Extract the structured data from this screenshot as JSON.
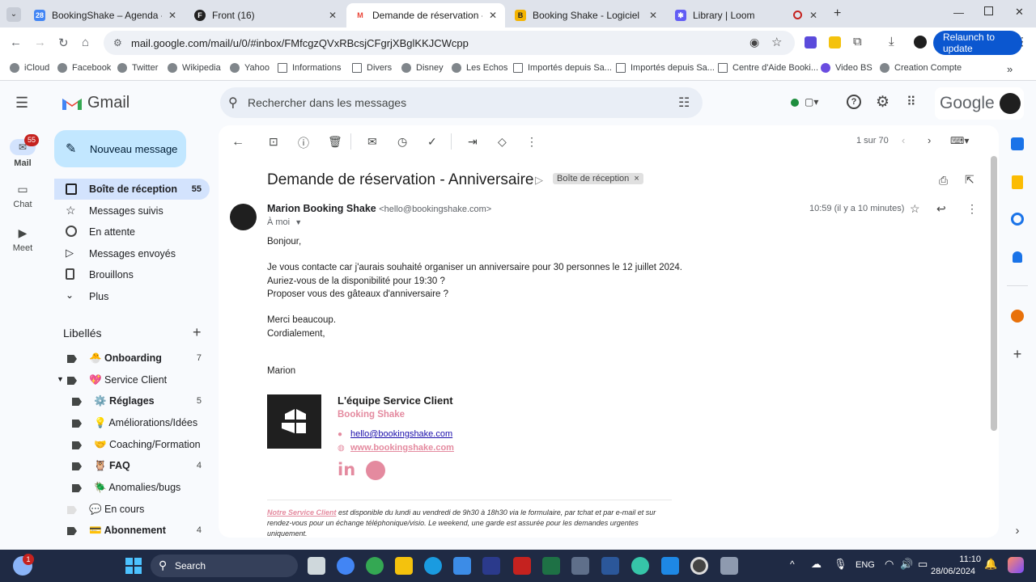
{
  "browser": {
    "tabs": [
      {
        "title": "BookingShake – Agenda - Sem",
        "color": "#4285f4",
        "glyph": "28"
      },
      {
        "title": "Front (16)",
        "color": "#222",
        "glyph": "F"
      },
      {
        "title": "Demande de réservation - Anni",
        "color": "#ea4335",
        "glyph": "M"
      },
      {
        "title": "Booking Shake - Logiciel Gestic",
        "color": "#f4b400",
        "glyph": "B"
      },
      {
        "title": "Library | Loom",
        "color": "#625df5",
        "glyph": "✱"
      }
    ],
    "url": "mail.google.com/mail/u/0/#inbox/FMfcgzQVxRBcsjCFgrjXBglKKJCWcpp",
    "relaunch_label": "Relaunch to update",
    "bookmarks": [
      "iCloud",
      "Facebook",
      "Twitter",
      "Wikipedia",
      "Yahoo",
      "Informations",
      "Divers",
      "Disney",
      "Les Echos",
      "Importés depuis Sa...",
      "Importés depuis Sa...",
      "Centre d'Aide Booki...",
      "Video BS",
      "Creation Compte"
    ]
  },
  "gmail": {
    "logo_text": "Gmail",
    "search_placeholder": "Rechercher dans les messages",
    "google_wordmark": "Google",
    "rail": {
      "mail": "Mail",
      "mail_badge": "55",
      "chat": "Chat",
      "meet": "Meet"
    },
    "compose_label": "Nouveau message",
    "nav": [
      {
        "label": "Boîte de réception",
        "count": "55"
      },
      {
        "label": "Messages suivis",
        "count": ""
      },
      {
        "label": "En attente",
        "count": ""
      },
      {
        "label": "Messages envoyés",
        "count": ""
      },
      {
        "label": "Brouillons",
        "count": ""
      },
      {
        "label": "Plus",
        "count": ""
      }
    ],
    "labels_heading": "Libellés",
    "labels": [
      {
        "name": "🐣 Onboarding",
        "count": "7"
      },
      {
        "name": "💖 Service Client",
        "count": ""
      },
      {
        "name": "⚙️ Réglages",
        "count": "5"
      },
      {
        "name": "💡 Améliorations/Idées",
        "count": ""
      },
      {
        "name": "🤝 Coaching/Formation",
        "count": ""
      },
      {
        "name": "🦉 FAQ",
        "count": "4"
      },
      {
        "name": "🪲 Anomalies/bugs",
        "count": ""
      },
      {
        "name": "💬 En cours",
        "count": ""
      },
      {
        "name": "💳 Abonnement",
        "count": "4"
      }
    ],
    "pager": "1 sur 70",
    "email": {
      "subject": "Demande de réservation - Anniversaire",
      "folder_chip": "Boîte de réception",
      "sender_name": "Marion Booking Shake",
      "sender_email": "<hello@bookingshake.com>",
      "to": "À moi",
      "time": "10:59 (il y a 10 minutes)",
      "body": [
        "Bonjour,",
        "Je vous contacte car j'aurais souhaité organiser un anniversaire pour 30 personnes le 12 juillet 2024.",
        "Auriez-vous de la disponibilité pour 19:30 ?",
        "Proposer vous des gâteaux d'anniversaire ?",
        "Merci beaucoup.",
        "Cordialement,",
        "Marion"
      ],
      "signature": {
        "team": "L'équipe Service Client",
        "company": "Booking Shake",
        "email": "hello@bookingshake.com",
        "website": "www.bookingshake.com"
      },
      "footer_link": "Notre Service Client",
      "footer_text": " est disponible du lundi au vendredi de 9h30 à 18h30 via le formulaire, par tchat et par e-mail et sur rendez-vous pour un échange téléphonique/visio. Le weekend, une garde est assurée pour les demandes urgentes uniquement."
    }
  },
  "taskbar": {
    "search_label": "Search",
    "lang": "ENG",
    "time": "11:10",
    "date": "28/06/2024",
    "notif_badge": "1"
  }
}
